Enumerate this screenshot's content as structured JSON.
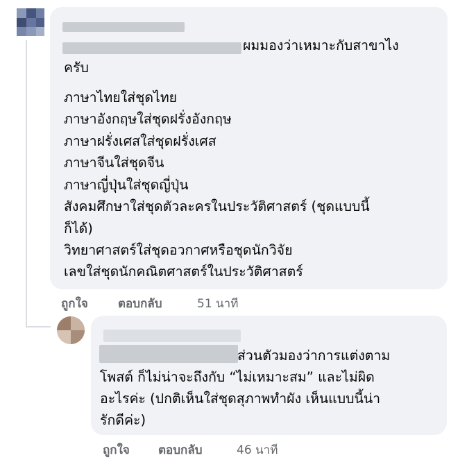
{
  "comment1": {
    "text_lines": [
      "ผมมองว่าเหมาะกับสาขาไง",
      "ครับ",
      "ภาษาไทยใส่ชุดไทย",
      "ภาษาอังกฤษใส่ชุดฝรั่งอังกฤษ",
      "ภาษาฝรั่งเศสใส่ชุดฝรั่งเศส",
      "ภาษาจีนใส่ชุดจีน",
      "ภาษาญี่ปุ่นใส่ชุดญี่ปุ่น",
      "สังคมศึกษาใส่ชุดตัวละครในประวัติศาสตร์ (ชุดแบบนี้",
      "ก็ได้)",
      "วิทยาศาสตร์ใส่ชุดอวกาศหรือชุดนักวิจัย",
      "เลขใส่ชุดนักคณิตศาสตร์ในประวัติศาสตร์"
    ],
    "actions": {
      "like": "ถูกใจ",
      "reply": "ตอบกลับ",
      "time": "51 นาที"
    }
  },
  "comment2": {
    "text_lines": [
      "ส่วนตัวมองว่าการแต่งตาม",
      "โพสต์ ก็ไม่น่าจะถึงกับ “ไม่เหมาะสม” และไม่ผิด",
      "อะไรค่ะ (ปกติเห็นใส่ชุดสุภาพทำผัง เห็นแบบนี้น่า",
      "รักดีค่ะ)"
    ],
    "actions": {
      "like": "ถูกใจ",
      "reply": "ตอบกลับ",
      "time": "46 นาที"
    }
  }
}
